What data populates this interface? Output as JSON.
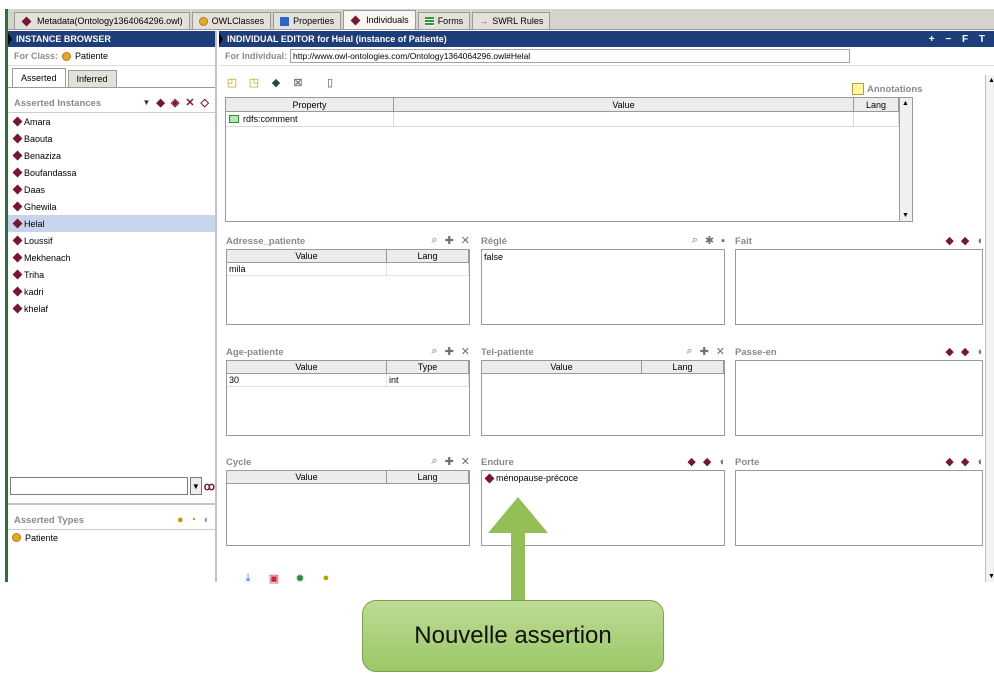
{
  "tabs": [
    {
      "label": "Metadata(Ontology1364064296.owl)",
      "icon": "diamond-icon"
    },
    {
      "label": "OWLClasses",
      "icon": "class-circle-icon"
    },
    {
      "label": "Properties",
      "icon": "properties-icon"
    },
    {
      "label": "Individuals",
      "icon": "diamond-icon",
      "active": true
    },
    {
      "label": "Forms",
      "icon": "forms-icon"
    },
    {
      "label": "SWRL Rules",
      "icon": "swrl-arrow-icon"
    }
  ],
  "left": {
    "title": "INSTANCE BROWSER",
    "for_class_label": "For Class:",
    "for_class_value": "Patiente",
    "subtabs": [
      "Asserted",
      "Inferred"
    ],
    "instances_header": "Asserted Instances",
    "instances": [
      "Amara",
      "Baouta",
      "Benaziza",
      "Boufandassa",
      "Daas",
      "Ghewila",
      "Helal",
      "Loussif",
      "Mekhenach",
      "Triha",
      "kadri",
      "khelaf"
    ],
    "selected_instance": "Helal",
    "filter_value": "",
    "types_header": "Asserted Types",
    "types": [
      "Patiente"
    ]
  },
  "right": {
    "title": "INDIVIDUAL EDITOR for Helal   (instance of Patiente)",
    "window_controls": "+ − F T",
    "for_individual_label": "For Individual:",
    "individual_url": "http://www.owl-ontologies.com/Ontology1364064296.owl#Helal",
    "annotations_label": "Annotations",
    "annotation_columns": [
      "Property",
      "Value",
      "Lang"
    ],
    "annotation_rows": [
      {
        "property": "rdfs:comment",
        "value": "",
        "lang": ""
      }
    ]
  },
  "widgets": {
    "adresse": {
      "title": "Adresse_patiente",
      "columns": [
        "Value",
        "Lang"
      ],
      "rows": [
        [
          "mila",
          ""
        ]
      ]
    },
    "regle": {
      "title": "Réglé",
      "text": "false"
    },
    "fait": {
      "title": "Fait"
    },
    "age": {
      "title": "Age-patiente",
      "columns": [
        "Value",
        "Type"
      ],
      "rows": [
        [
          "30",
          "int"
        ]
      ]
    },
    "tel": {
      "title": "Tel-patiente",
      "columns": [
        "Value",
        "Lang"
      ],
      "rows": []
    },
    "passe": {
      "title": "Passe-en"
    },
    "cycle": {
      "title": "Cycle",
      "columns": [
        "Value",
        "Lang"
      ],
      "rows": []
    },
    "endure": {
      "title": "Endure",
      "items": [
        "ménopause-précoce"
      ]
    },
    "porte": {
      "title": "Porte"
    }
  },
  "callout": {
    "text": "Nouvelle assertion"
  },
  "colors": {
    "title_bar": "#1d3e7a",
    "accent": "#7a1530",
    "callout": "#9cc767"
  }
}
